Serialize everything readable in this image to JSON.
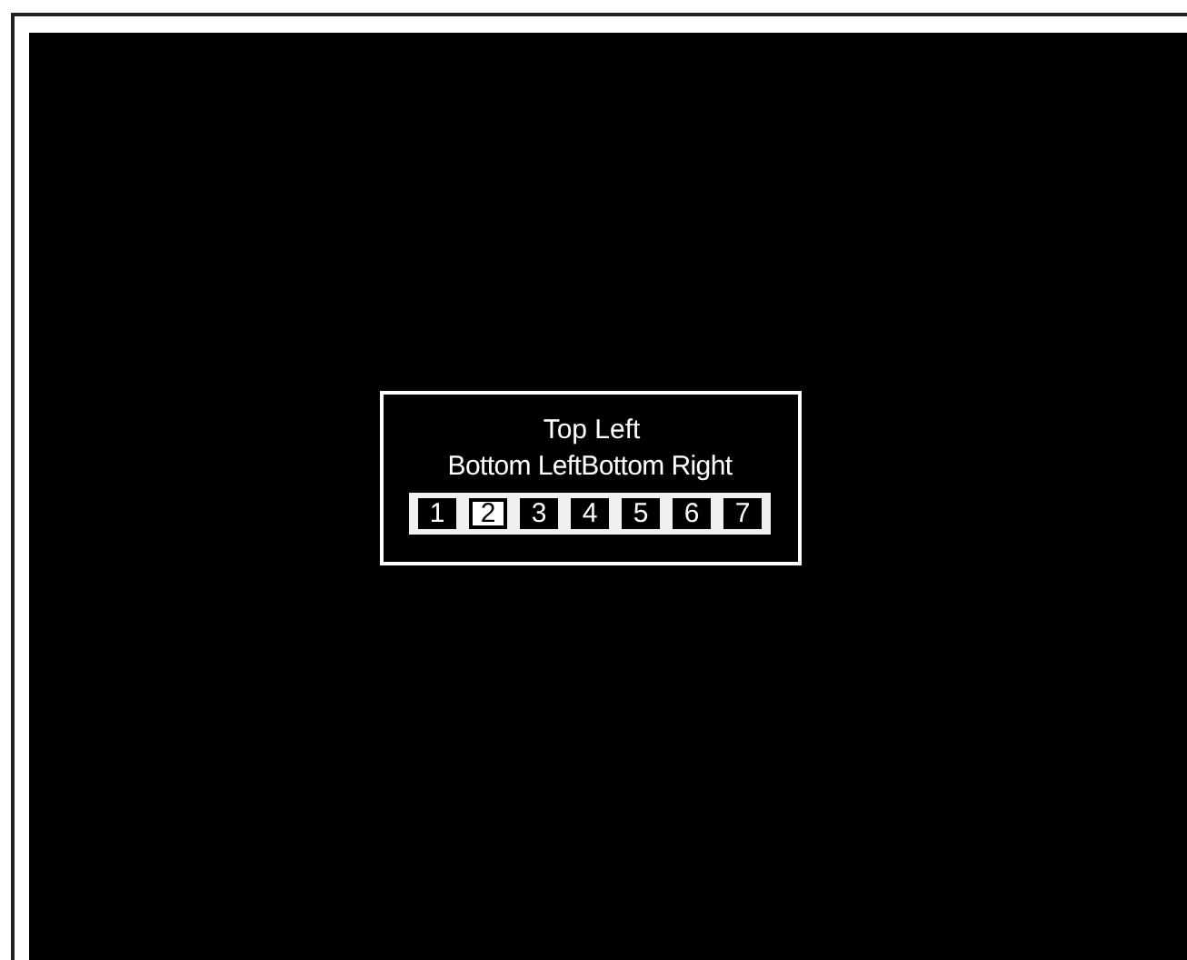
{
  "panel": {
    "title": "Top Left",
    "left_label": "Bottom Left",
    "right_label": "Bottom Right"
  },
  "pages": [
    {
      "label": "1",
      "selected": false
    },
    {
      "label": "2",
      "selected": true
    },
    {
      "label": "3",
      "selected": false
    },
    {
      "label": "4",
      "selected": false
    },
    {
      "label": "5",
      "selected": false
    },
    {
      "label": "6",
      "selected": false
    },
    {
      "label": "7",
      "selected": false
    }
  ]
}
